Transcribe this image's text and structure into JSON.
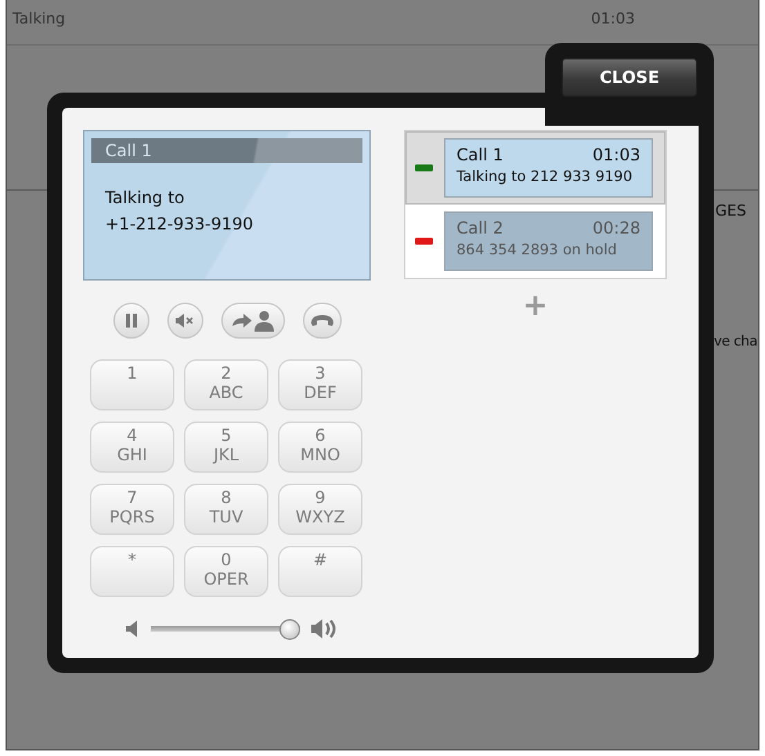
{
  "background": {
    "status": "Talking",
    "time": "01:03",
    "heading_fragment": "GES",
    "text_fragment": "ve cha"
  },
  "close_button": "CLOSE",
  "active_call": {
    "title": "Call 1",
    "line1": "Talking to",
    "line2": "+1-212-933-9190"
  },
  "call_controls": [
    {
      "kind": "hold"
    },
    {
      "kind": "mute"
    },
    {
      "kind": "transfer"
    },
    {
      "kind": "hangup"
    }
  ],
  "keypad": [
    {
      "digit": "1"
    },
    {
      "digit": "2",
      "letters": "ABC"
    },
    {
      "digit": "3",
      "letters": "DEF"
    },
    {
      "digit": "4",
      "letters": "GHI"
    },
    {
      "digit": "5",
      "letters": "JKL"
    },
    {
      "digit": "6",
      "letters": "MNO"
    },
    {
      "digit": "7",
      "letters": "PQRS"
    },
    {
      "digit": "8",
      "letters": "TUV"
    },
    {
      "digit": "9",
      "letters": "WXYZ"
    },
    {
      "digit": "*"
    },
    {
      "digit": "0",
      "letters": "OPER"
    },
    {
      "digit": "#"
    }
  ],
  "volume": {
    "level": 1
  },
  "calls": [
    {
      "name": "Call 1",
      "time": "01:03",
      "detail": "Talking to 212 933 9190",
      "selected": true,
      "held": false,
      "color": "#1a7a1a"
    },
    {
      "name": "Call 2",
      "time": "00:28",
      "detail": "864 354 2893 on hold",
      "selected": false,
      "held": true,
      "color": "#e01818"
    }
  ],
  "add_call": "+"
}
